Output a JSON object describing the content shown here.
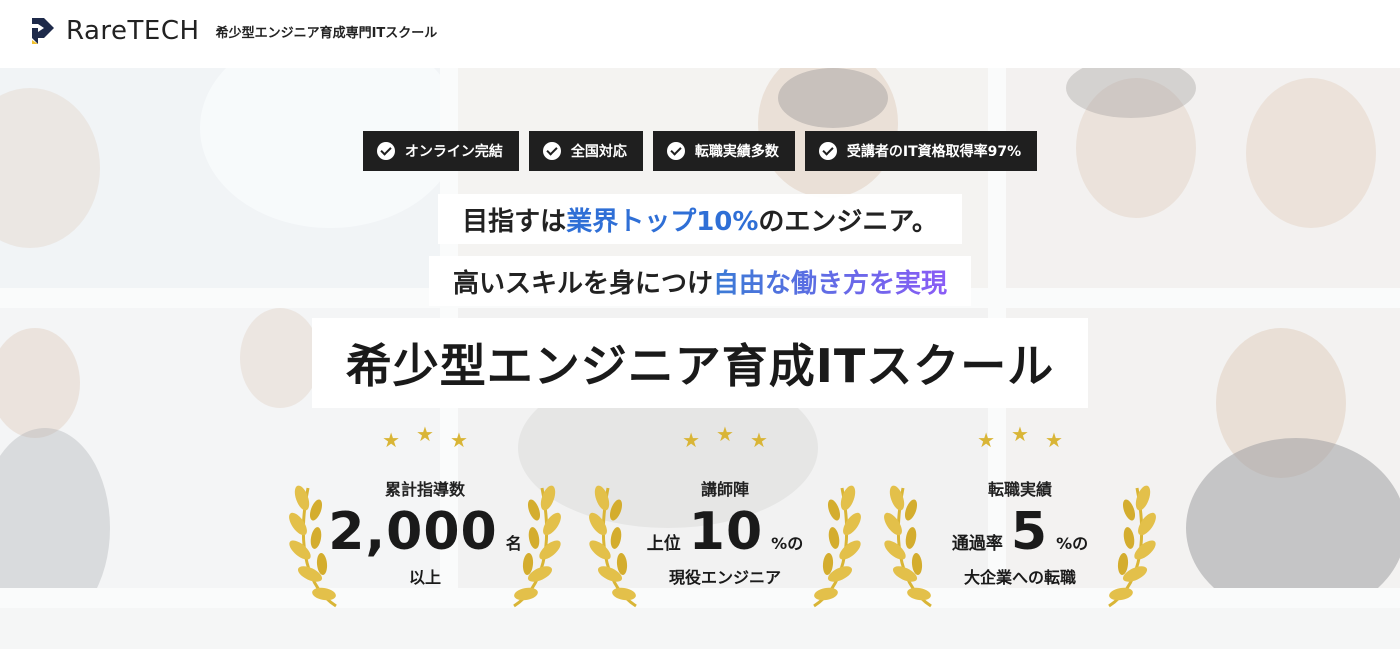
{
  "header": {
    "brand": "RareTECH",
    "tagline": "希少型エンジニア育成専門ITスクール"
  },
  "badges": [
    {
      "label": "オンライン完結"
    },
    {
      "label": "全国対応"
    },
    {
      "label": "転職実績多数"
    },
    {
      "label": "受講者のIT資格取得率97%"
    }
  ],
  "catch1": {
    "before": "目指すは",
    "highlight": "業界トップ10%",
    "after": "のエンジニア。"
  },
  "catch2": {
    "before": "高いスキルを身につけ",
    "highlight": "自由な働き方を実現"
  },
  "main_title": "希少型エンジニア育成ITスクール",
  "stats": [
    {
      "label": "累計指導数",
      "prefix": "",
      "value": "2,000",
      "unit": "名",
      "sub": "以上"
    },
    {
      "label": "講師陣",
      "prefix": "上位",
      "value": "10",
      "unit": "%の",
      "sub": "現役エンジニア"
    },
    {
      "label": "転職実績",
      "prefix": "通過率",
      "value": "5",
      "unit": "%の",
      "sub": "大企業への転職"
    }
  ],
  "colors": {
    "accent_blue": "#2f6fd6",
    "accent_purple": "#8a5cf6",
    "badge_bg": "#1f1f1f",
    "star_gold": "#d9b536",
    "logo_yellow": "#f2c230",
    "logo_navy": "#1e2a4a"
  },
  "icons": {
    "badge_icon": "check-circle-icon",
    "stat_decoration": "laurel-wreath-icon",
    "stat_stars": "star-icon"
  }
}
